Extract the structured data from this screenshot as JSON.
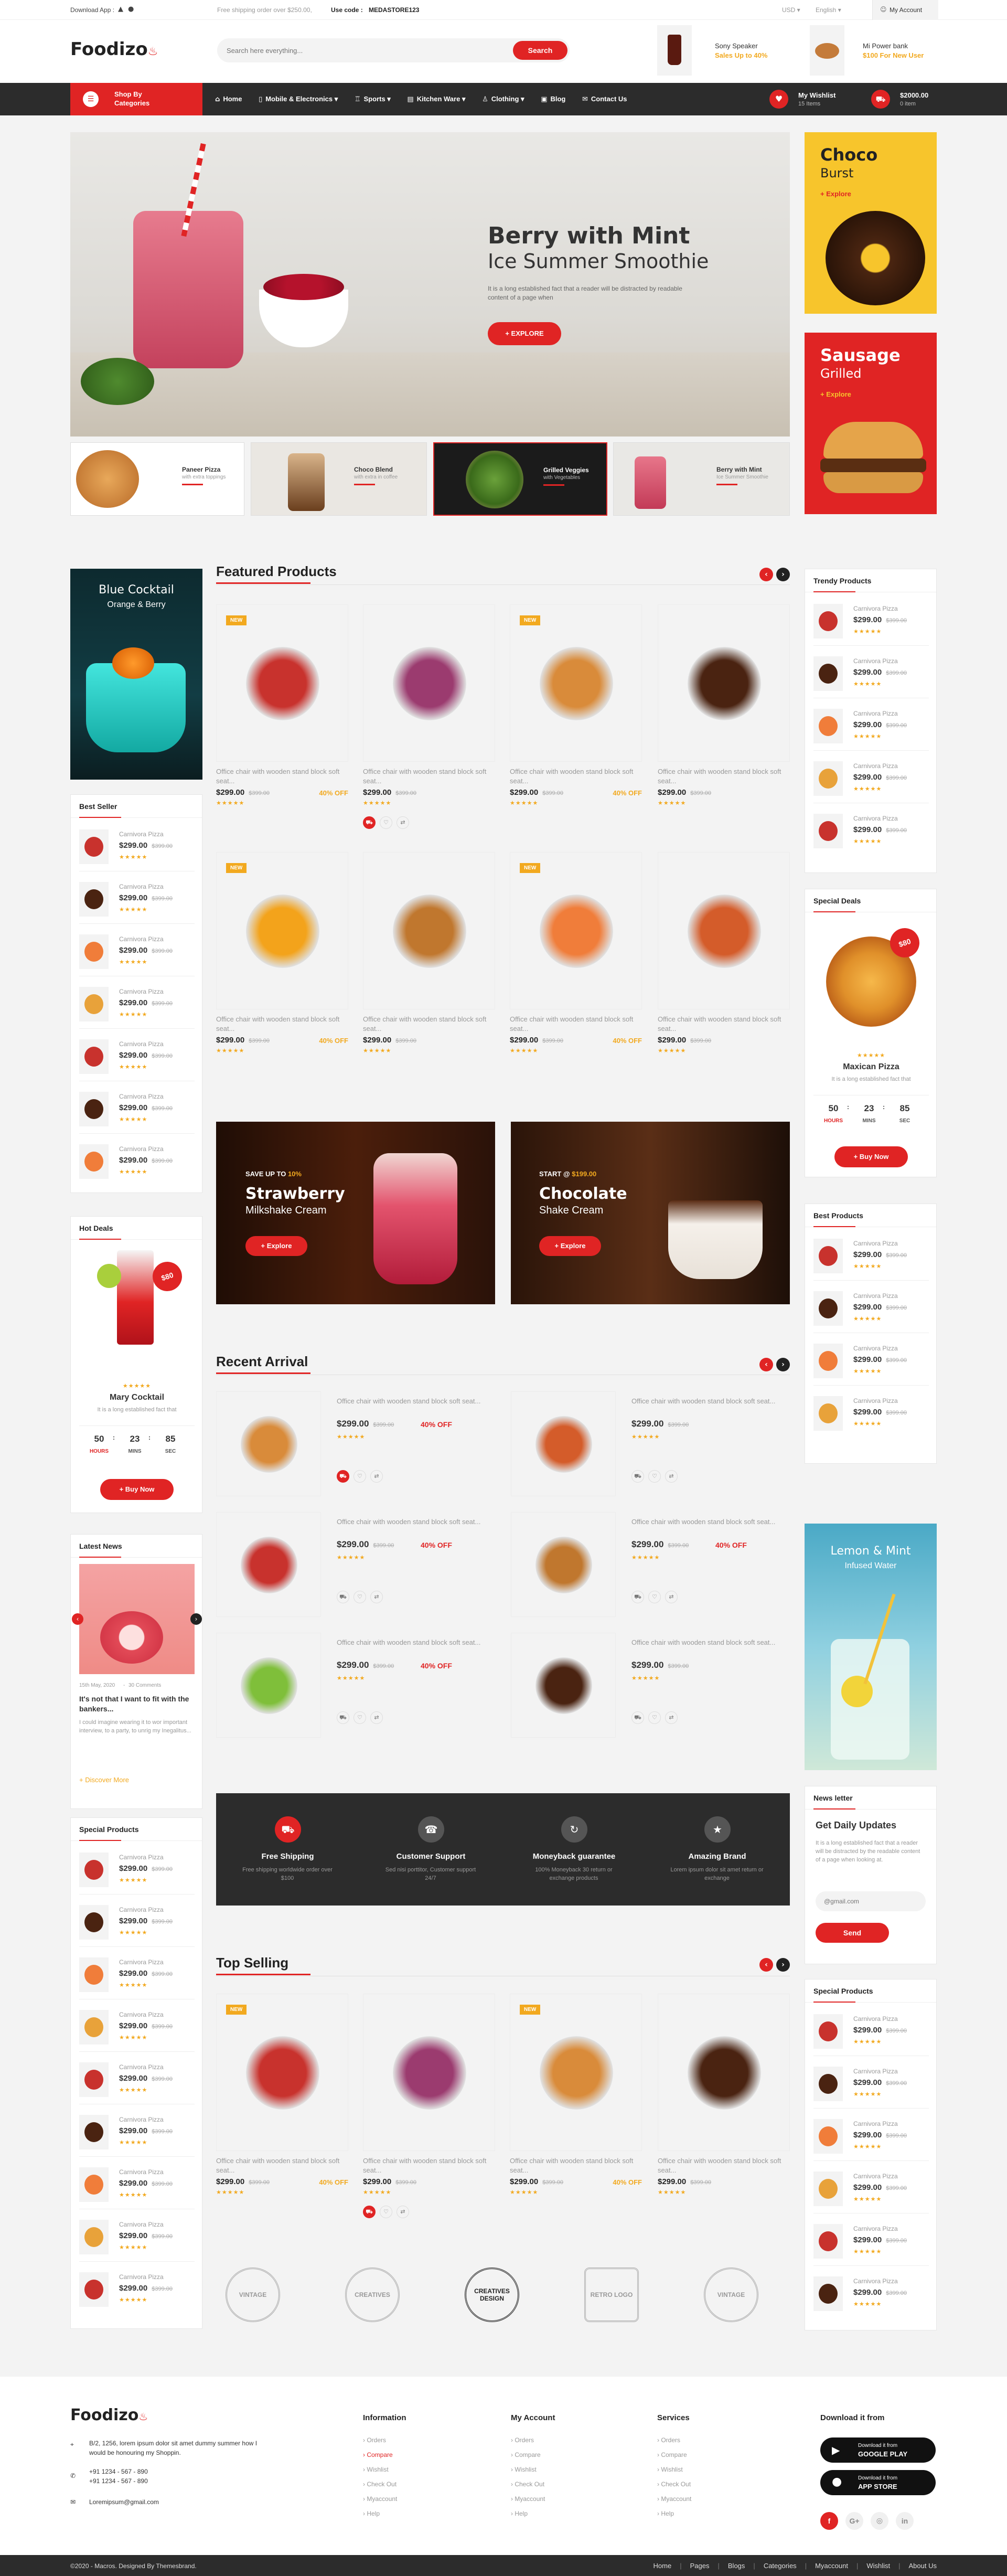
{
  "topbar": {
    "download_app": "Download App :",
    "promo": "Free shipping order over $250.00,",
    "use_code_label": "Use code :",
    "use_code": "MEDASTORE123",
    "currency": "USD",
    "language": "English",
    "my_account": "My Account"
  },
  "header": {
    "logo": "Foodizo",
    "search_placeholder": "Search here everything...",
    "search_button": "Search",
    "promo1_title": "Sony Speaker",
    "promo1_sub": "Sales Up to 40%",
    "promo2_title": "Mi Power bank",
    "promo2_sub": "$100 For New User"
  },
  "nav": {
    "categories_line1": "Shop By",
    "categories_line2": "Categories",
    "items": [
      "Home",
      "Mobile & Electronics",
      "Sports",
      "Kitchen Ware",
      "Clothing",
      "Blog",
      "Contact Us"
    ],
    "wishlist_title": "My Wishlist",
    "wishlist_count": "15 Items",
    "cart_total": "$2000.00",
    "cart_count": "0 item"
  },
  "hero": {
    "title": "Berry with Mint",
    "subtitle": "Ice Summer Smoothie",
    "text": "It is a long established fact that a reader will be distracted by readable content of a page when",
    "button": "+ EXPLORE",
    "thumbs": [
      {
        "title": "Paneer Pizza",
        "sub": "with extra toppings"
      },
      {
        "title": "Choco Blend",
        "sub": "with extra in coffee"
      },
      {
        "title": "Grilled Veggies",
        "sub": "with Vegetables"
      },
      {
        "title": "Berry with Mint",
        "sub": "Ice Summer Smoothie"
      }
    ]
  },
  "side_banners": {
    "b1_title": "Choco",
    "b1_sub": "Burst",
    "b1_link": "+ Explore",
    "b2_title": "Sausage",
    "b2_sub": "Grilled",
    "b2_link": "+ Explore"
  },
  "left_sidebar": {
    "banner_title": "Blue Cocktail",
    "banner_sub": "Orange & Berry",
    "best_seller_heading": "Best Seller",
    "hot_deals_heading": "Hot Deals",
    "hot_deal_badge": "$80",
    "hot_deal_name": "Mary Cocktail",
    "hot_deal_text": "It is a long established fact that",
    "hot_deal_countdown": [
      "50",
      "23",
      "85"
    ],
    "countdown_labels": [
      "HOURS",
      "MINS",
      "SEC"
    ],
    "hot_deal_button": "+ Buy Now",
    "latest_news_heading": "Latest News",
    "news_date": "15th May, 2020",
    "news_comments": "30 Comments",
    "news_title": "It's not that I want to fit with the bankers...",
    "news_text": "I could imagine wearing it to wor important interview, to a party, to unrig my Inegalitus...",
    "news_link": "+ Discover More",
    "special_products_heading": "Special Products"
  },
  "product_mini": {
    "name": "Carnivora Pizza",
    "price": "$299.00",
    "old": "$399.00",
    "stars": "★★★★★"
  },
  "featured": {
    "heading": "Featured Products",
    "title": "Office chair with wooden stand block soft seat...",
    "price": "$299.00",
    "old": "$399.00",
    "off": "40% OFF",
    "new_badge": "NEW"
  },
  "promo_banners": {
    "b1_pre": "SAVE UP TO",
    "b1_pct": "10%",
    "b1_title": "Strawberry",
    "b1_sub": "Milkshake Cream",
    "b1_btn": "+ Explore",
    "b2_pre": "START @",
    "b2_price": "$199.00",
    "b2_title": "Chocolate",
    "b2_sub": "Shake Cream",
    "b2_btn": "+ Explore"
  },
  "recent": {
    "heading": "Recent Arrival"
  },
  "services": [
    {
      "title": "Free Shipping",
      "text": "Free shipping worldwide order over $100"
    },
    {
      "title": "Customer Support",
      "text": "Sed nisi porttitor, Customer support 24/7"
    },
    {
      "title": "Moneyback guarantee",
      "text": "100% Moneyback 30 return or exchange products"
    },
    {
      "title": "Amazing Brand",
      "text": "Lorem ipsum dolor sit amet return or exchange"
    }
  ],
  "top_selling": {
    "heading": "Top Selling"
  },
  "brands": [
    "VINTAGE",
    "CREATIVES",
    "CREATIVES DESIGN",
    "RETRO LOGO",
    "VINTAGE"
  ],
  "right_sidebar": {
    "trendy_heading": "Trendy Products",
    "special_deals_heading": "Special Deals",
    "deal_badge": "$80",
    "deal_name": "Maxican Pizza",
    "deal_text": "It is a long established fact that",
    "deal_countdown": [
      "50",
      "23",
      "85"
    ],
    "deal_button": "+ Buy Now",
    "best_products_heading": "Best Products",
    "banner_title": "Lemon & Mint",
    "banner_sub": "Infused Water",
    "newsletter_heading": "News letter",
    "newsletter_title": "Get Daily Updates",
    "newsletter_text": "It is a long established fact that a reader will be distracted by the readable content of a page when looking at.",
    "newsletter_placeholder": "@gmail.com",
    "newsletter_button": "Send",
    "special_products_heading": "Special Products"
  },
  "footer": {
    "logo": "Foodizo",
    "address": "B/2, 1256, lorem ipsum dolor sit amet dummy summer how I would be honouring my Shoppin.",
    "phone1": "+91 1234 - 567 - 890",
    "phone2": "+91 1234 - 567 - 890",
    "email": "Loremipsum@gmail.com",
    "info_heading": "Information",
    "info_items": [
      "Orders",
      "Compare",
      "Wishlist",
      "Check Out",
      "Myaccount",
      "Help"
    ],
    "account_heading": "My Account",
    "account_items": [
      "Orders",
      "Compare",
      "Wishlist",
      "Check Out",
      "Myaccount",
      "Help"
    ],
    "services_heading": "Services",
    "services_items": [
      "Orders",
      "Compare",
      "Wishlist",
      "Check Out",
      "Myaccount",
      "Help"
    ],
    "download_heading": "Download it from",
    "gplay_small": "Download it from",
    "gplay_big": "GOOGLE PLAY",
    "appstore_small": "Download it from",
    "appstore_big": "APP STORE",
    "social": [
      "f",
      "G+",
      "◎",
      "in"
    ],
    "copyright": "©2020 - Macros. Designed By Themesbrand.",
    "bottom_links": [
      "Home",
      "Pages",
      "Blogs",
      "Categories",
      "Myaccount",
      "Wishlist",
      "About Us"
    ]
  },
  "colors": {
    "accent": "#e02424",
    "dark": "#2c2c2c",
    "star": "#f2a91f",
    "yellow_banner": "#f7c52c"
  }
}
